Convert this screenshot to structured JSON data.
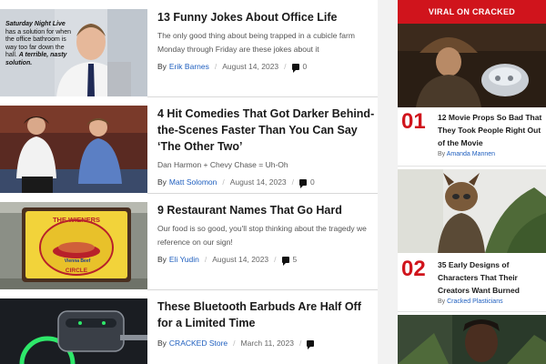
{
  "articles": [
    {
      "title": "13 Funny Jokes About Office Life",
      "subtitle": "The only good thing about being trapped in a cubicle farm Monday through Friday are these jokes about it",
      "author": "Erik Barnes",
      "date": "August 14, 2023",
      "comments": "0",
      "thumb_caption": [
        "Saturday Night Live",
        "has a solution for when",
        "the office bathroom is",
        "way too far down the",
        "hall.",
        "A terrible, nasty",
        "solution."
      ]
    },
    {
      "title": "4 Hit Comedies That Got Darker Behind-the-Scenes Faster Than You Can Say ‘The Other Two’",
      "subtitle": "Dan Harmon + Chevy Chase = Uh-Oh",
      "author": "Matt Solomon",
      "date": "August 14, 2023",
      "comments": "0"
    },
    {
      "title": "9 Restaurant Names That Go Hard",
      "subtitle": "Our food is so good, you'll stop thinking about the tragedy we reference on our sign!",
      "author": "Eli Yudin",
      "date": "August 14, 2023",
      "comments": "5",
      "thumb_sign": [
        "THE WIENERS",
        "Vienna Beef",
        "CIRCLE"
      ]
    },
    {
      "title": "These Bluetooth Earbuds Are Half Off for a Limited Time",
      "subtitle": "",
      "author": "CRACKED Store",
      "date": "March 11, 2023",
      "comments": ""
    }
  ],
  "by_label": "By",
  "sidebar": {
    "header": "VIRAL ON CRACKED",
    "items": [
      {
        "rank": "01",
        "title": "12 Movie Props So Bad That They Took People Right Out of the Movie",
        "author": "Amanda Mannen"
      },
      {
        "rank": "02",
        "title": "35 Early Designs of Characters That Their Creators Want Burned",
        "author": "Cracked Plasticians"
      }
    ]
  },
  "colors": {
    "accent": "#d0141c",
    "link": "#1f5fbf"
  }
}
